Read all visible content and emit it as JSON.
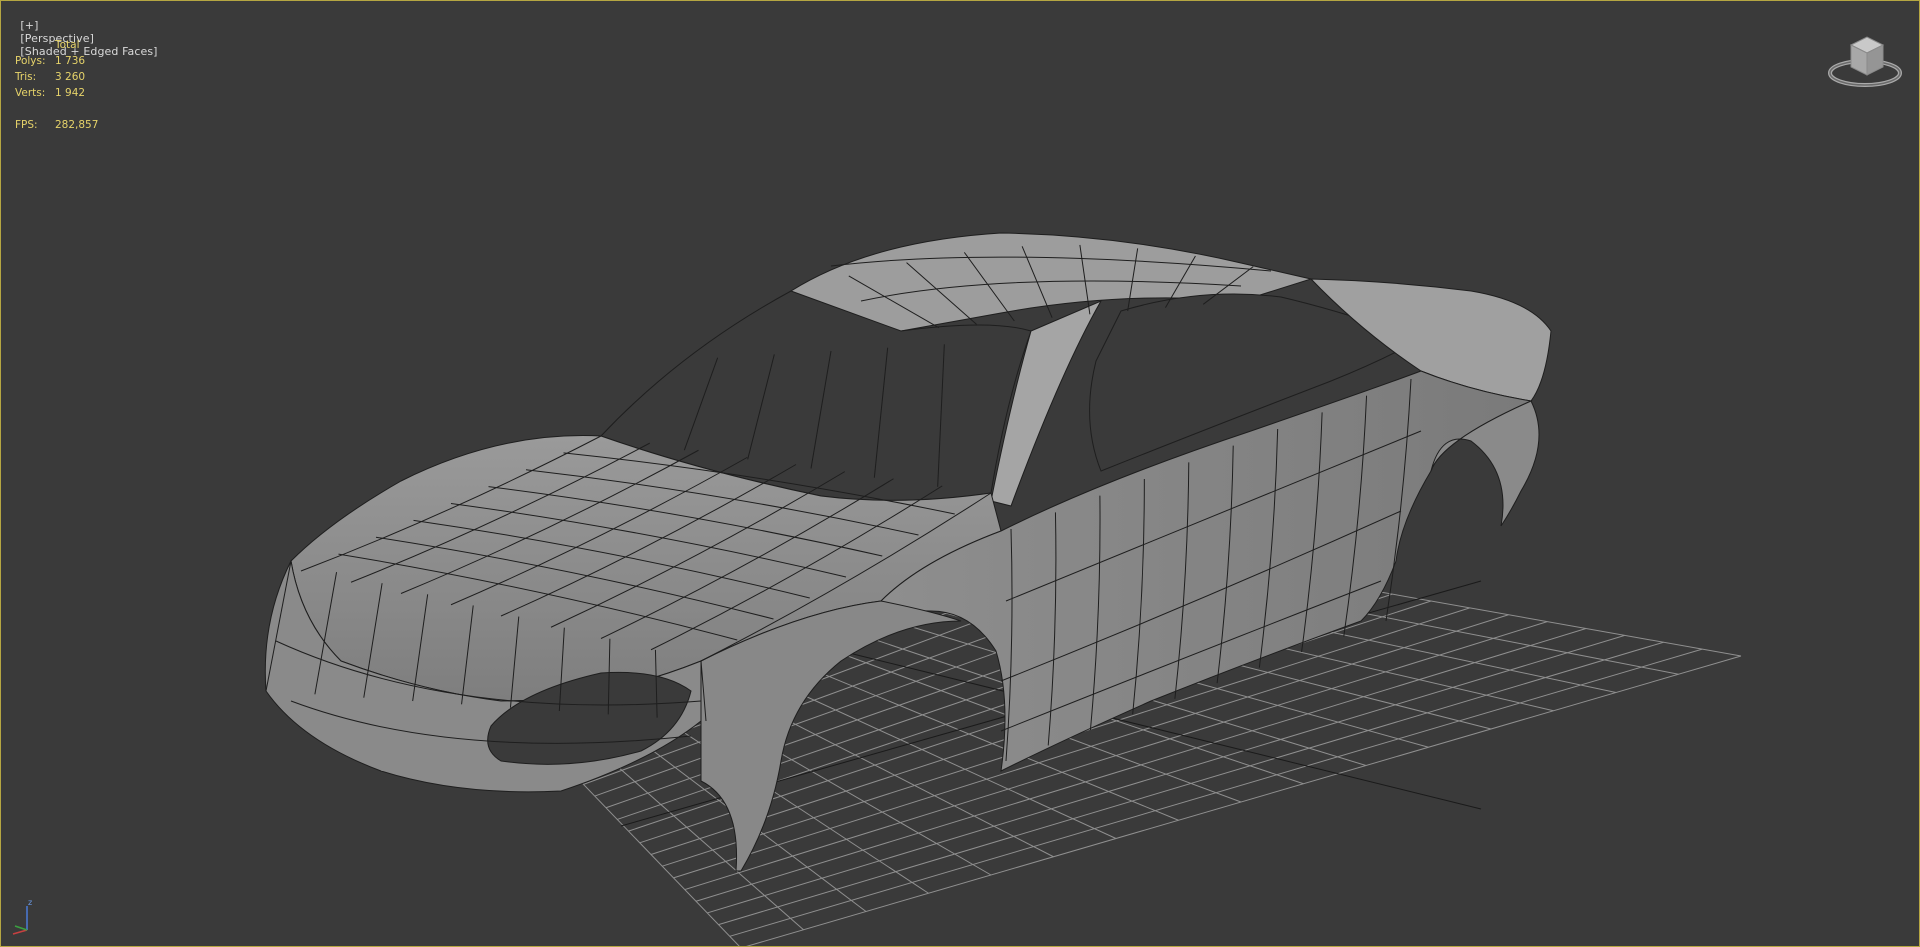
{
  "viewport": {
    "label_plus": "[+]",
    "label_view": "[Perspective]",
    "label_shading": "[Shaded + Edged Faces]"
  },
  "stats": {
    "header": "Total",
    "polys_label": "Polys:",
    "polys_value": "1 736",
    "tris_label": "Tris:",
    "tris_value": "3 260",
    "verts_label": "Verts:",
    "verts_value": "1 942",
    "fps_label": "FPS:",
    "fps_value": "282,857"
  },
  "axis": {
    "z_label": "z"
  },
  "colors": {
    "background": "#3a3a3a",
    "border": "#b5a642",
    "stats_text": "#e6d36a",
    "grid": "#8a8a8a",
    "mesh_fill": "#8c8c8c",
    "mesh_edge": "#1e1e1e"
  },
  "icons": {
    "viewcube": "viewcube-icon",
    "axis": "axis-tripod-icon"
  }
}
